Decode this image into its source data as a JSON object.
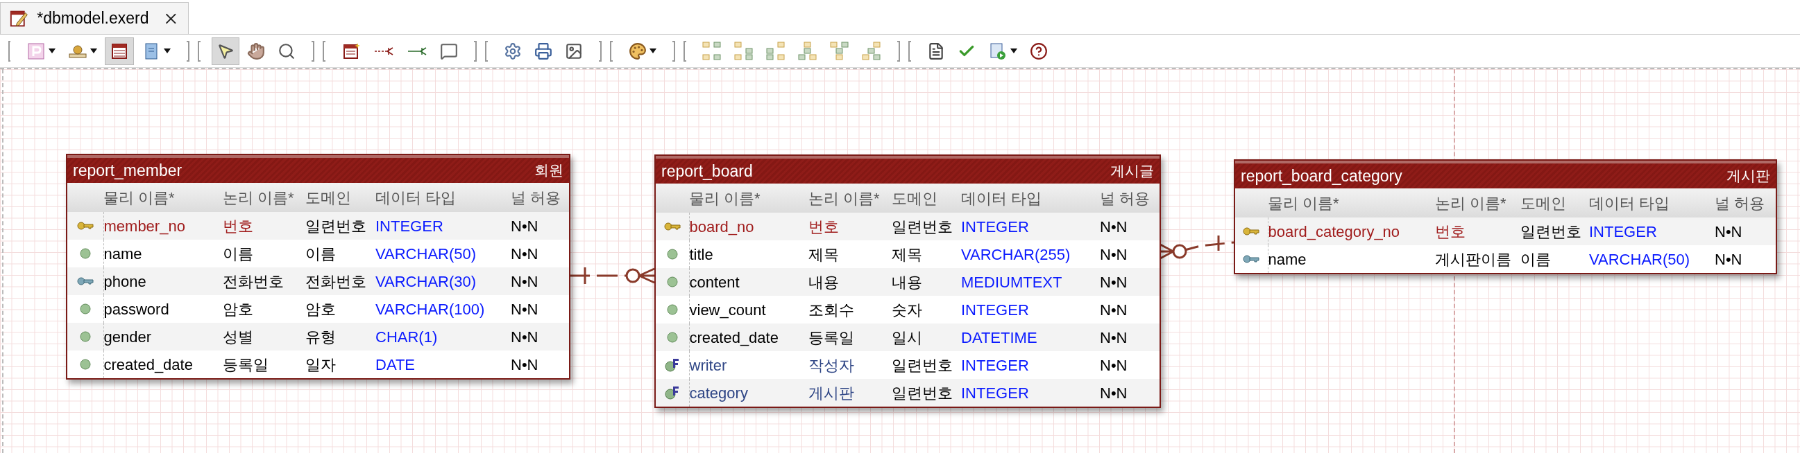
{
  "tab": {
    "title": "*dbmodel.exerd",
    "selected": true
  },
  "toolbar": [
    {
      "selected": false
    },
    {
      "selected": false
    },
    {
      "selected": true
    },
    {
      "selected": false
    },
    {
      "selected": true
    },
    {
      "selected": false
    },
    {
      "selected": false
    },
    {
      "selected": false
    },
    {
      "selected": false
    },
    {
      "selected": false
    },
    {
      "selected": false
    },
    {
      "selected": false
    },
    {
      "selected": false
    },
    {
      "selected": false
    },
    {
      "selected": false
    },
    {
      "selected": false
    },
    {
      "selected": false
    },
    {
      "selected": false
    },
    {
      "selected": false
    },
    {
      "selected": false
    },
    {
      "selected": false
    },
    {
      "selected": false
    },
    {
      "selected": false
    },
    {
      "selected": false
    },
    {
      "selected": false
    }
  ],
  "tables": [
    {
      "name": "report_member",
      "logical_name": "회원",
      "headers": [
        "물리 이름*",
        "논리 이름*",
        "도메인",
        "데이터 타입",
        "널 허용"
      ],
      "columns": [
        {
          "kind": "pk",
          "physical": "member_no",
          "logical": "번호",
          "domain": "일련번호",
          "type": "INTEGER",
          "null": "N•N"
        },
        {
          "kind": "attr",
          "physical": "name",
          "logical": "이름",
          "domain": "이름",
          "type": "VARCHAR(50)",
          "null": "N•N"
        },
        {
          "kind": "ak",
          "physical": "phone",
          "logical": "전화번호",
          "domain": "전화번호",
          "type": "VARCHAR(30)",
          "null": "N•N"
        },
        {
          "kind": "attr",
          "physical": "password",
          "logical": "암호",
          "domain": "암호",
          "type": "VARCHAR(100)",
          "null": "N•N"
        },
        {
          "kind": "attr",
          "physical": "gender",
          "logical": "성별",
          "domain": "유형",
          "type": "CHAR(1)",
          "null": "N•N"
        },
        {
          "kind": "attr",
          "physical": "created_date",
          "logical": "등록일",
          "domain": "일자",
          "type": "DATE",
          "null": "N•N"
        }
      ]
    },
    {
      "name": "report_board",
      "logical_name": "게시글",
      "headers": [
        "물리 이름*",
        "논리 이름*",
        "도메인",
        "데이터 타입",
        "널 허용"
      ],
      "columns": [
        {
          "kind": "pk",
          "physical": "board_no",
          "logical": "번호",
          "domain": "일련번호",
          "type": "INTEGER",
          "null": "N•N"
        },
        {
          "kind": "attr",
          "physical": "title",
          "logical": "제목",
          "domain": "제목",
          "type": "VARCHAR(255)",
          "null": "N•N"
        },
        {
          "kind": "attr",
          "physical": "content",
          "logical": "내용",
          "domain": "내용",
          "type": "MEDIUMTEXT",
          "null": "N•N"
        },
        {
          "kind": "attr",
          "physical": "view_count",
          "logical": "조회수",
          "domain": "숫자",
          "type": "INTEGER",
          "null": "N•N"
        },
        {
          "kind": "attr",
          "physical": "created_date",
          "logical": "등록일",
          "domain": "일시",
          "type": "DATETIME",
          "null": "N•N"
        },
        {
          "kind": "fk",
          "physical": "writer",
          "logical": "작성자",
          "domain": "일련번호",
          "type": "INTEGER",
          "null": "N•N"
        },
        {
          "kind": "fk",
          "physical": "category",
          "logical": "게시판",
          "domain": "일련번호",
          "type": "INTEGER",
          "null": "N•N"
        }
      ]
    },
    {
      "name": "report_board_category",
      "logical_name": "게시판",
      "headers": [
        "물리 이름*",
        "논리 이름*",
        "도메인",
        "데이터 타입",
        "널 허용"
      ],
      "columns": [
        {
          "kind": "pk",
          "physical": "board_category_no",
          "logical": "번호",
          "domain": "일련번호",
          "type": "INTEGER",
          "null": "N•N"
        },
        {
          "kind": "ak",
          "physical": "name",
          "logical": "게시판이름",
          "domain": "이름",
          "type": "VARCHAR(50)",
          "null": "N•N"
        }
      ]
    }
  ]
}
